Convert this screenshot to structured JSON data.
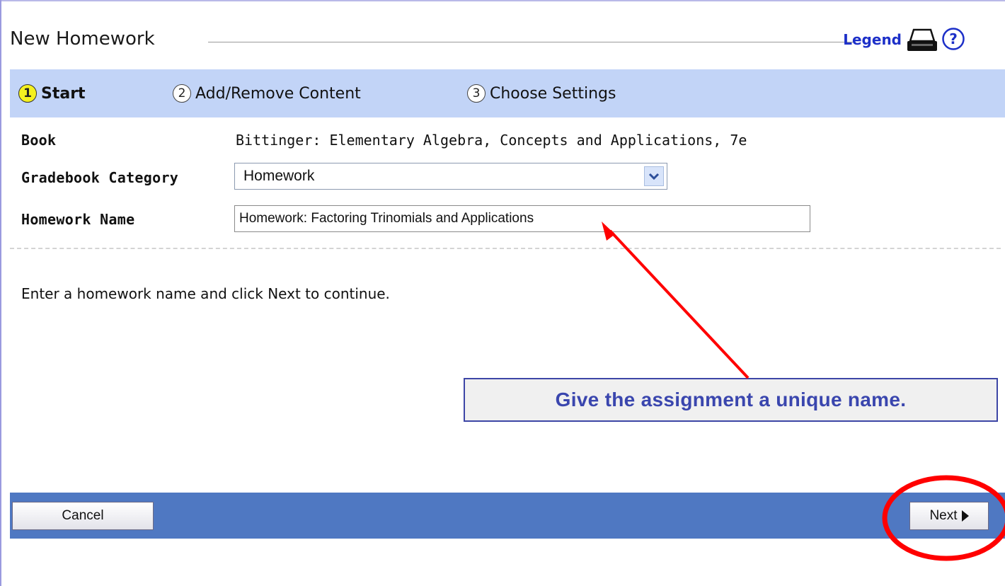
{
  "header": {
    "title": "New Homework",
    "legend_label": "Legend",
    "icons": [
      "printer-icon",
      "help-icon"
    ]
  },
  "steps": [
    {
      "number": "1",
      "label": "Start",
      "active": true
    },
    {
      "number": "2",
      "label": "Add/Remove Content",
      "active": false
    },
    {
      "number": "3",
      "label": "Choose Settings",
      "active": false
    }
  ],
  "form": {
    "book_label": "Book",
    "book_value": "Bittinger: Elementary Algebra, Concepts and Applications, 7e",
    "category_label": "Gradebook Category",
    "category_value": "Homework",
    "name_label": "Homework Name",
    "name_value": "Homework: Factoring Trinomials and Applications"
  },
  "instruction": "Enter a homework name and click Next to continue.",
  "annotation": {
    "callout_text": "Give the assignment a unique name.",
    "arrow_color": "#ff0000",
    "circle_color": "#ff0000"
  },
  "footer": {
    "cancel_label": "Cancel",
    "next_label": "Next"
  },
  "colors": {
    "steps_bar": "#c2d4f7",
    "footer_bar": "#4f78c2",
    "legend_link": "#1c2fc8",
    "callout_text": "#3a46ae",
    "active_step_badge": "#f4f020"
  }
}
